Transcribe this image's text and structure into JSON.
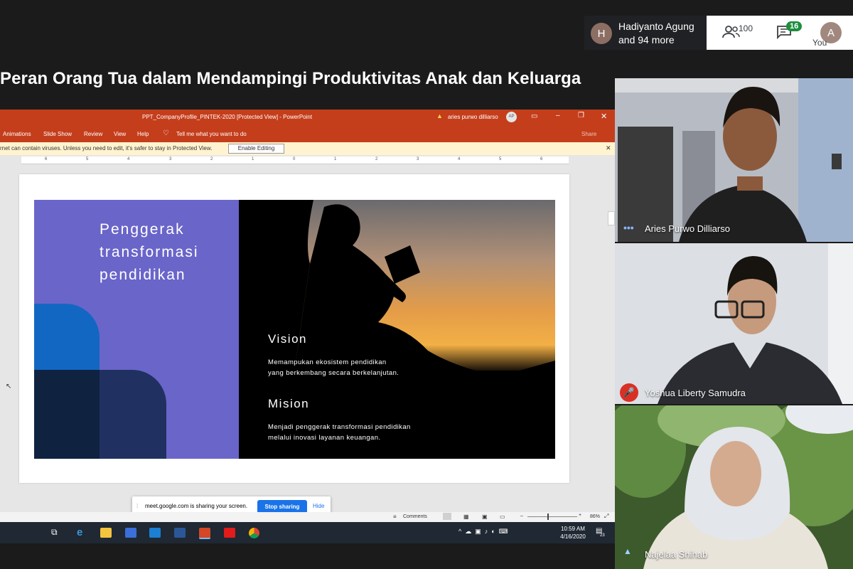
{
  "meeting": {
    "title": "Peran Orang Tua dalam Mendampingi Produktivitas Anak dan Keluarga",
    "presenter_initial": "H",
    "presenter_line1": "Hadiyanto Agung",
    "presenter_line2": "and 94 more",
    "people_count": "100",
    "chat_count": "16",
    "you_initial": "A",
    "you_label": "You"
  },
  "ppt": {
    "window_title": "PPT_CompanyProfile_PINTEK-2020 [Protected View]  -  PowerPoint",
    "user_name": "aries purwo dilliarso",
    "user_initials": "AP",
    "ribbon": [
      "Animations",
      "Slide Show",
      "Review",
      "View",
      "Help"
    ],
    "tell_me": "Tell me what you want to do",
    "share": "Share",
    "protected_msg": "rnet can contain viruses. Unless you need to edit, it's safer to stay in Protected View.",
    "enable_editing": "Enable Editing",
    "ruler_numbers": [
      "6",
      "5",
      "4",
      "3",
      "2",
      "1",
      "0",
      "1",
      "2",
      "3",
      "4",
      "5",
      "6"
    ],
    "comments": "Comments",
    "zoom": "86%"
  },
  "slide": {
    "heading_lines": [
      "Penggerak",
      "transformasi",
      "pendidikan"
    ],
    "vision_title": "Vision",
    "vision_lines": [
      "Memampukan ekosistem pendidikan",
      "yang berkembang secara berkelanjutan."
    ],
    "mission_title": "Mision",
    "mission_lines": [
      "Menjadi penggerak transformasi pendidikan",
      "melalui inovasi layanan keuangan."
    ]
  },
  "share_bar": {
    "message": "meet.google.com is sharing your screen.",
    "stop": "Stop sharing",
    "hide": "Hide"
  },
  "taskbar": {
    "time": "10:59 AM",
    "date": "4/16/2020",
    "notif_count": "23"
  },
  "participants": [
    {
      "name": "Aries Purwo Dilliarso",
      "status": "speaking"
    },
    {
      "name": "Yoshua Liberty Samudra",
      "status": "muted"
    },
    {
      "name": "Najelaa Shihab",
      "status": "normal"
    }
  ],
  "colors": {
    "ppt_accent": "#c43e1c",
    "slide_purple": "#6a65c9",
    "meet_green": "#1e8e3e",
    "meet_blue": "#1a73e8",
    "mute_red": "#d93025"
  }
}
